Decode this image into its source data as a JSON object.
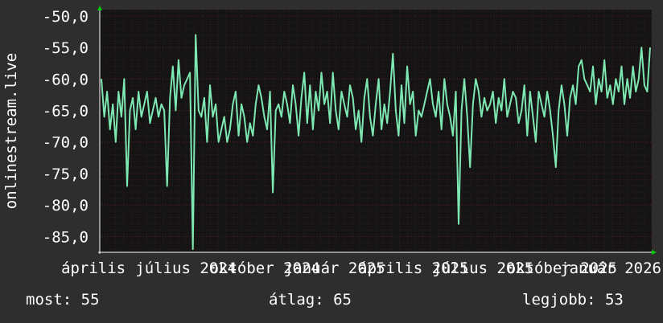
{
  "chart_data": {
    "type": "line",
    "ylabel": "onlinestream.live",
    "ylim": [
      -87.5,
      -49
    ],
    "y_ticks": [
      "-50,0",
      "-55,0",
      "-60,0",
      "-65,0",
      "-70,0",
      "-75,0",
      "-80,0",
      "-85,0"
    ],
    "y_tick_values": [
      -50,
      -55,
      -60,
      -65,
      -70,
      -75,
      -80,
      -85
    ],
    "x_tick_labels": [
      "április",
      "július 2024",
      "október 2024",
      "január 2025",
      "április 2025",
      "július 2025",
      "október 2025",
      "január 2026"
    ],
    "grid": true,
    "colors": {
      "background": "#2e2e2e",
      "plot": "#141414",
      "grid": "#5a2222",
      "line": "#7ee8b2",
      "axis": "#ffffff",
      "arrow": "#00cc00"
    },
    "series": [
      {
        "values": [
          -60,
          -66,
          -62,
          -68,
          -64,
          -70,
          -62,
          -66,
          -60,
          -77,
          -65,
          -63,
          -68,
          -62,
          -66,
          -64,
          -62,
          -67,
          -65,
          -63,
          -66,
          -64,
          -65,
          -77,
          -63,
          -58,
          -65,
          -57,
          -63,
          -61,
          -60,
          -59,
          -87,
          -53,
          -65,
          -66,
          -63,
          -70,
          -61,
          -66,
          -64,
          -70,
          -68,
          -66,
          -70,
          -68,
          -64,
          -62,
          -69,
          -64,
          -66,
          -70,
          -67,
          -69,
          -64,
          -61,
          -63,
          -66,
          -68,
          -62,
          -78,
          -65,
          -64,
          -66,
          -62,
          -64,
          -67,
          -61,
          -64,
          -69,
          -63,
          -59,
          -67,
          -61,
          -68,
          -62,
          -65,
          -59,
          -64,
          -62,
          -67,
          -59,
          -65,
          -68,
          -62,
          -64,
          -66,
          -61,
          -63,
          -68,
          -65,
          -70,
          -63,
          -60,
          -66,
          -69,
          -64,
          -60,
          -68,
          -64,
          -67,
          -62,
          -56,
          -65,
          -69,
          -61,
          -67,
          -58,
          -64,
          -62,
          -69,
          -65,
          -66,
          -64,
          -62,
          -60,
          -64,
          -66,
          -62,
          -68,
          -60,
          -64,
          -66,
          -69,
          -62,
          -83,
          -65,
          -60,
          -66,
          -74,
          -64,
          -60,
          -62,
          -66,
          -63,
          -65,
          -64,
          -62,
          -67,
          -63,
          -65,
          -60,
          -66,
          -64,
          -62,
          -63,
          -67,
          -65,
          -61,
          -69,
          -62,
          -66,
          -70,
          -62,
          -64,
          -66,
          -62,
          -65,
          -69,
          -74,
          -65,
          -61,
          -64,
          -69,
          -63,
          -61,
          -64,
          -58,
          -57,
          -60,
          -61,
          -62,
          -58,
          -64,
          -60,
          -62,
          -57,
          -63,
          -61,
          -64,
          -60,
          -62,
          -58,
          -64,
          -60,
          -63,
          -58,
          -62,
          -60,
          -55,
          -61,
          -62,
          -55
        ]
      }
    ]
  },
  "footer": {
    "now": "most: 55",
    "avg": "átlag: 65",
    "best": "legjobb: 53"
  }
}
